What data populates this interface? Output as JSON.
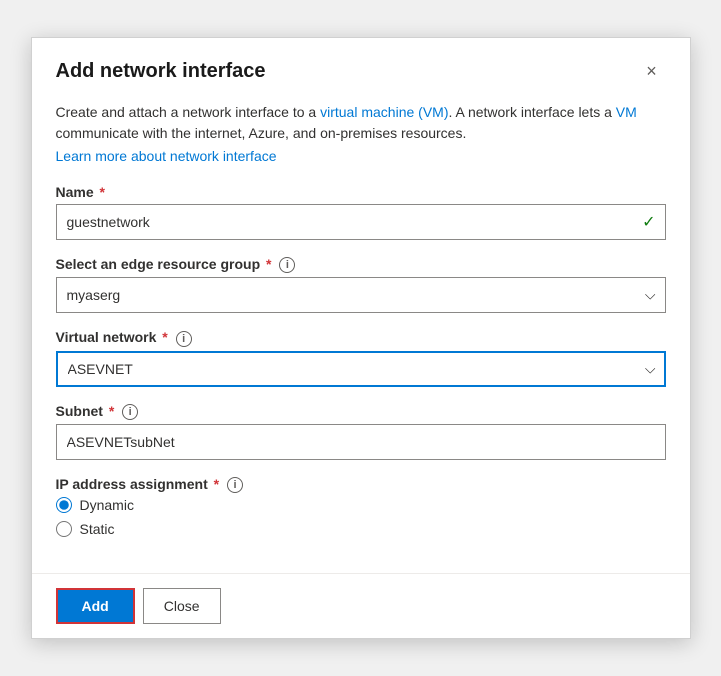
{
  "dialog": {
    "title": "Add network interface",
    "close_label": "×"
  },
  "description": {
    "text": "Create and attach a network interface to a virtual machine (VM). A network interface lets a VM communicate with the internet, Azure, and on-premises resources.",
    "link_text": "Learn more about network interface"
  },
  "fields": {
    "name": {
      "label": "Name",
      "required": true,
      "value": "guestnetwork",
      "has_check": true
    },
    "edge_resource_group": {
      "label": "Select an edge resource group",
      "required": true,
      "has_info": true,
      "value": "myaserg"
    },
    "virtual_network": {
      "label": "Virtual network",
      "required": true,
      "has_info": true,
      "value": "ASEVNET"
    },
    "subnet": {
      "label": "Subnet",
      "required": true,
      "has_info": true,
      "value": "ASEVNETsubNet"
    },
    "ip_assignment": {
      "label": "IP address assignment",
      "required": true,
      "has_info": true,
      "options": [
        {
          "value": "dynamic",
          "label": "Dynamic",
          "checked": true
        },
        {
          "value": "static",
          "label": "Static",
          "checked": false
        }
      ]
    }
  },
  "footer": {
    "add_label": "Add",
    "close_label": "Close"
  },
  "icons": {
    "check": "✓",
    "chevron_down": "⌄",
    "info": "i",
    "close": "✕"
  }
}
